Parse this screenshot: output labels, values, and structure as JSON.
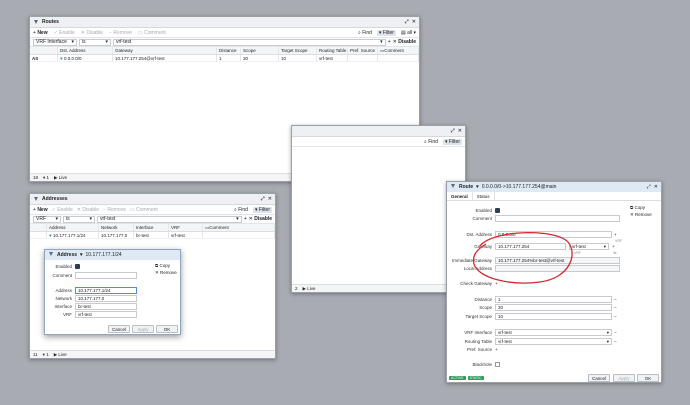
{
  "routes_win": {
    "title": "Routes",
    "toolbar": {
      "new": "New",
      "enable": "Enable",
      "disable": "Disable",
      "remove": "Remove",
      "comment": "Comment",
      "find": "Find",
      "filter": "Filter",
      "all": "all"
    },
    "filter": {
      "field": "VRF Interface",
      "op": "is",
      "value": "vrf-test",
      "disable": "Disable"
    },
    "columns": [
      "",
      "Dst. Address",
      "Gateway",
      "Distance",
      "Scope",
      "Target Scope",
      "Routing Table",
      "Pref. Source",
      "Comment"
    ],
    "rows": [
      [
        "AS",
        "0.0.0.0/0",
        "10.177.177.254@vrf-test",
        "1",
        "30",
        "10",
        "vrf-test",
        "",
        ""
      ]
    ],
    "status": {
      "count": "18",
      "filter": "1",
      "live": "Live"
    }
  },
  "middle_win": {
    "find": "Find",
    "filter": "Filter",
    "status": {
      "count": "2",
      "live": "Live"
    }
  },
  "addresses_win": {
    "title": "Addresses",
    "toolbar": {
      "new": "New",
      "enable": "Enable",
      "disable": "Disable",
      "remove": "Remove",
      "comment": "Comment",
      "find": "Find",
      "filter": "Filter"
    },
    "filter": {
      "field": "VRF",
      "op": "is",
      "value": "vrf-test",
      "disable": "Disable"
    },
    "columns": [
      "",
      "Address",
      "Network",
      "Interface",
      "VRF",
      "Comment"
    ],
    "rows": [
      [
        "",
        "10.177.177.1/24",
        "10.177.177.0",
        "br-test",
        "vrf-test",
        ""
      ]
    ],
    "status": {
      "count": "11",
      "filter": "1",
      "live": "Live"
    }
  },
  "address_dialog": {
    "title": "Address",
    "subtitle": "10.177.177.1/24",
    "enabled_label": "Enabled",
    "comment_label": "Comment",
    "address_label": "Address",
    "address_value": "10.177.177.1/24",
    "network_label": "Network",
    "network_value": "10.177.177.0",
    "interface_label": "Interface",
    "interface_value": "br-test",
    "vrf_label": "VRF",
    "vrf_value": "vrf-test",
    "copy": "Copy",
    "remove": "Remove",
    "cancel": "Cancel",
    "apply": "Apply",
    "ok": "OK"
  },
  "route_dialog": {
    "title": "Route",
    "subtitle": "0.0.0.0/0->10.177.177.254@main",
    "tab_general": "General",
    "tab_status": "Status",
    "copy": "Copy",
    "remove": "Remove",
    "enabled_label": "Enabled",
    "comment_label": "Comment",
    "dst_label": "Dst. Address",
    "dst_value": "0.0.0.0/0",
    "dst_hint": "VRF",
    "gateway_label": "Gateway",
    "gateway_value": "10.177.177.254",
    "gateway_vrf": "vrf-test",
    "gateway_hint_vrf": "VRF",
    "gateway_hint_ifs": "ifs",
    "imm_gw_label": "Immediate Gateway",
    "imm_gw_value": "10.177.177.254%br-test@vrf-test",
    "local_label": "Local Address",
    "check_gw_label": "Check Gateway",
    "distance_label": "Distance",
    "distance_value": "1",
    "scope_label": "Scope",
    "scope_value": "30",
    "target_scope_label": "Target Scope",
    "target_scope_value": "10",
    "vrf_iface_label": "VRF Interface",
    "vrf_iface_value": "vrf-test",
    "routing_table_label": "Routing Table",
    "routing_table_value": "vrf-test",
    "pref_source_label": "Pref. Source",
    "blackhole_label": "Blackhole",
    "badge_active": "ACTIVE",
    "badge_static": "STATIC",
    "cancel": "Cancel",
    "apply": "Apply",
    "ok": "OK"
  }
}
